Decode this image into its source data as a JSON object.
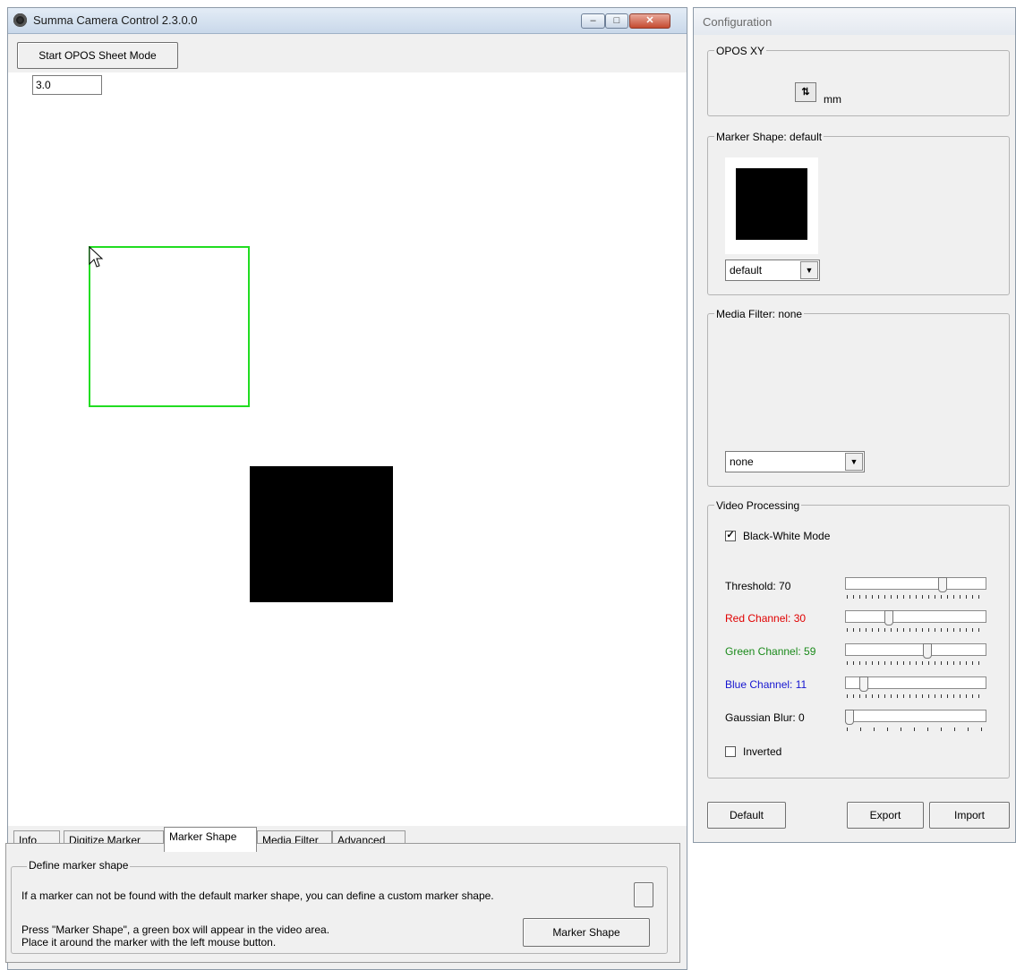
{
  "main_window": {
    "title": "Summa Camera Control 2.3.0.0",
    "start_button": "Start OPOS Sheet Mode",
    "tabs": [
      "Info",
      "Digitize Marker",
      "Marker Shape",
      "Media Filter",
      "Advanced"
    ],
    "active_tab": "Marker Shape",
    "define_group": {
      "legend": "Define marker shape",
      "line1": "If a marker can not be found with the default marker shape, you can define a custom marker shape.",
      "line2": "Press \"Marker Shape\", a green box will appear in the video area.",
      "line3": "Place it around the marker with the left mouse button.",
      "button": "Marker Shape"
    }
  },
  "config_window": {
    "title": "Configuration",
    "opos_xy": {
      "legend": "OPOS XY",
      "value": "3.0",
      "unit": "mm"
    },
    "marker_shape": {
      "legend": "Marker Shape: default",
      "selected": "default"
    },
    "media_filter": {
      "legend": "Media Filter: none",
      "selected": "none"
    },
    "video_processing": {
      "legend": "Video Processing",
      "black_white_label": "Black-White Mode",
      "black_white_checked": true,
      "threshold_label": "Threshold: 70",
      "threshold_value": 70,
      "red_label": "Red Channel: 30",
      "red_value": 30,
      "green_label": "Green Channel: 59",
      "green_value": 59,
      "blue_label": "Blue Channel: 11",
      "blue_value": 11,
      "blur_label": "Gaussian Blur: 0",
      "blur_value": 0,
      "inverted_label": "Inverted",
      "inverted_checked": false
    },
    "buttons": {
      "default": "Default",
      "export": "Export",
      "import": "Import"
    },
    "colors": {
      "red_label": "#e00000",
      "green_label": "#1a8a1a",
      "blue_label": "#1515d0",
      "marker_box": "#22dd22"
    }
  }
}
